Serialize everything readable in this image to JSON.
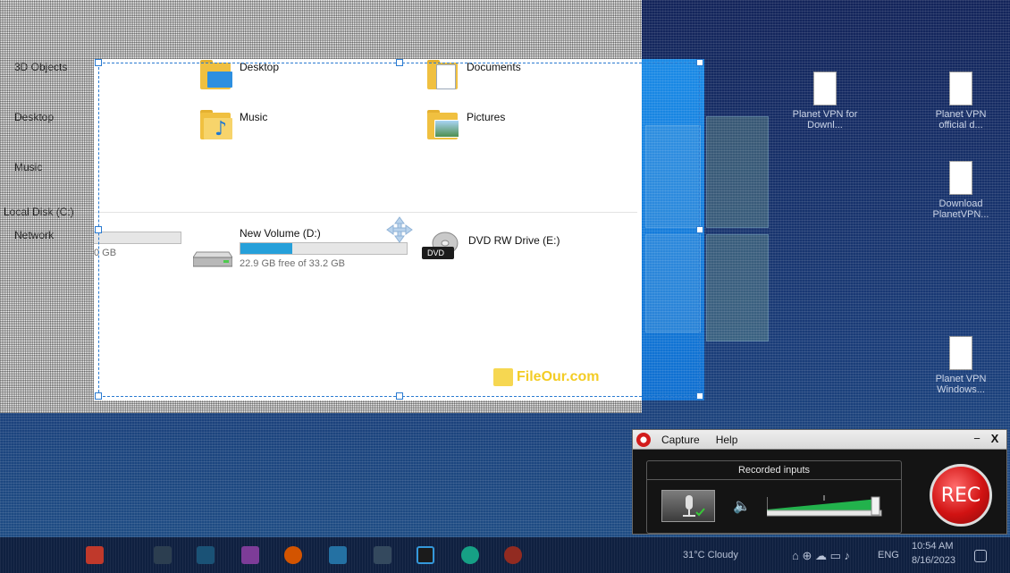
{
  "explorer": {
    "sidebar": [
      "3D Objects",
      "Desktop",
      "Music",
      "Local Disk (C:)",
      "Network"
    ],
    "folders": [
      {
        "label": "Desktop",
        "icon": "desktop-folder-icon"
      },
      {
        "label": "Documents",
        "icon": "documents-folder-icon"
      },
      {
        "label": "Music",
        "icon": "music-folder-icon"
      },
      {
        "label": "Pictures",
        "icon": "pictures-folder-icon"
      }
    ],
    "drives": [
      {
        "label": "",
        "free": "0 GB",
        "used_fraction": 0.0,
        "icon": "local-disk-icon"
      },
      {
        "label": "New Volume (D:)",
        "free": "22.9 GB free of 33.2 GB",
        "used_fraction": 0.31,
        "icon": "hard-drive-icon"
      },
      {
        "label": "DVD RW Drive (E:)",
        "free": "",
        "icon": "dvd-drive-icon",
        "badge": "DVD"
      }
    ]
  },
  "watermark": "FileOur.com",
  "desktop_icons": [
    {
      "label": "Planet VPN for Downl...",
      "icon": "file-icon"
    },
    {
      "label": "Planet VPN official d...",
      "icon": "file-icon"
    },
    {
      "label": "Download PlanetVPN...",
      "icon": "file-icon"
    },
    {
      "label": "Planet VPN Windows...",
      "icon": "file-icon"
    }
  ],
  "recorder": {
    "menu": [
      "Capture",
      "Help"
    ],
    "minimize": "−",
    "close": "X",
    "panel_title": "Recorded inputs",
    "rec_label": "REC",
    "volume_level": 0.95,
    "accent": "#d11212"
  },
  "taskbar": {
    "weather": "31°C  Cloudy",
    "lang": "ENG",
    "time": "10:54 AM",
    "date": "8/16/2023"
  }
}
